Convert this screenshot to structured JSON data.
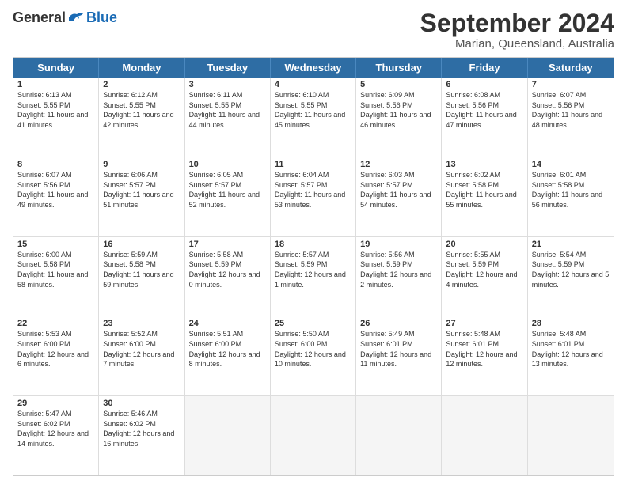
{
  "logo": {
    "general": "General",
    "blue": "Blue"
  },
  "title": "September 2024",
  "location": "Marian, Queensland, Australia",
  "days": [
    "Sunday",
    "Monday",
    "Tuesday",
    "Wednesday",
    "Thursday",
    "Friday",
    "Saturday"
  ],
  "weeks": [
    [
      {
        "day": "1",
        "sunrise": "6:13 AM",
        "sunset": "5:55 PM",
        "daylight": "11 hours and 41 minutes."
      },
      {
        "day": "2",
        "sunrise": "6:12 AM",
        "sunset": "5:55 PM",
        "daylight": "11 hours and 42 minutes."
      },
      {
        "day": "3",
        "sunrise": "6:11 AM",
        "sunset": "5:55 PM",
        "daylight": "11 hours and 44 minutes."
      },
      {
        "day": "4",
        "sunrise": "6:10 AM",
        "sunset": "5:55 PM",
        "daylight": "11 hours and 45 minutes."
      },
      {
        "day": "5",
        "sunrise": "6:09 AM",
        "sunset": "5:56 PM",
        "daylight": "11 hours and 46 minutes."
      },
      {
        "day": "6",
        "sunrise": "6:08 AM",
        "sunset": "5:56 PM",
        "daylight": "11 hours and 47 minutes."
      },
      {
        "day": "7",
        "sunrise": "6:07 AM",
        "sunset": "5:56 PM",
        "daylight": "11 hours and 48 minutes."
      }
    ],
    [
      {
        "day": "8",
        "sunrise": "6:07 AM",
        "sunset": "5:56 PM",
        "daylight": "11 hours and 49 minutes."
      },
      {
        "day": "9",
        "sunrise": "6:06 AM",
        "sunset": "5:57 PM",
        "daylight": "11 hours and 51 minutes."
      },
      {
        "day": "10",
        "sunrise": "6:05 AM",
        "sunset": "5:57 PM",
        "daylight": "11 hours and 52 minutes."
      },
      {
        "day": "11",
        "sunrise": "6:04 AM",
        "sunset": "5:57 PM",
        "daylight": "11 hours and 53 minutes."
      },
      {
        "day": "12",
        "sunrise": "6:03 AM",
        "sunset": "5:57 PM",
        "daylight": "11 hours and 54 minutes."
      },
      {
        "day": "13",
        "sunrise": "6:02 AM",
        "sunset": "5:58 PM",
        "daylight": "11 hours and 55 minutes."
      },
      {
        "day": "14",
        "sunrise": "6:01 AM",
        "sunset": "5:58 PM",
        "daylight": "11 hours and 56 minutes."
      }
    ],
    [
      {
        "day": "15",
        "sunrise": "6:00 AM",
        "sunset": "5:58 PM",
        "daylight": "11 hours and 58 minutes."
      },
      {
        "day": "16",
        "sunrise": "5:59 AM",
        "sunset": "5:58 PM",
        "daylight": "11 hours and 59 minutes."
      },
      {
        "day": "17",
        "sunrise": "5:58 AM",
        "sunset": "5:59 PM",
        "daylight": "12 hours and 0 minutes."
      },
      {
        "day": "18",
        "sunrise": "5:57 AM",
        "sunset": "5:59 PM",
        "daylight": "12 hours and 1 minute."
      },
      {
        "day": "19",
        "sunrise": "5:56 AM",
        "sunset": "5:59 PM",
        "daylight": "12 hours and 2 minutes."
      },
      {
        "day": "20",
        "sunrise": "5:55 AM",
        "sunset": "5:59 PM",
        "daylight": "12 hours and 4 minutes."
      },
      {
        "day": "21",
        "sunrise": "5:54 AM",
        "sunset": "5:59 PM",
        "daylight": "12 hours and 5 minutes."
      }
    ],
    [
      {
        "day": "22",
        "sunrise": "5:53 AM",
        "sunset": "6:00 PM",
        "daylight": "12 hours and 6 minutes."
      },
      {
        "day": "23",
        "sunrise": "5:52 AM",
        "sunset": "6:00 PM",
        "daylight": "12 hours and 7 minutes."
      },
      {
        "day": "24",
        "sunrise": "5:51 AM",
        "sunset": "6:00 PM",
        "daylight": "12 hours and 8 minutes."
      },
      {
        "day": "25",
        "sunrise": "5:50 AM",
        "sunset": "6:00 PM",
        "daylight": "12 hours and 10 minutes."
      },
      {
        "day": "26",
        "sunrise": "5:49 AM",
        "sunset": "6:01 PM",
        "daylight": "12 hours and 11 minutes."
      },
      {
        "day": "27",
        "sunrise": "5:48 AM",
        "sunset": "6:01 PM",
        "daylight": "12 hours and 12 minutes."
      },
      {
        "day": "28",
        "sunrise": "5:48 AM",
        "sunset": "6:01 PM",
        "daylight": "12 hours and 13 minutes."
      }
    ],
    [
      {
        "day": "29",
        "sunrise": "5:47 AM",
        "sunset": "6:02 PM",
        "daylight": "12 hours and 14 minutes."
      },
      {
        "day": "30",
        "sunrise": "5:46 AM",
        "sunset": "6:02 PM",
        "daylight": "12 hours and 16 minutes."
      },
      null,
      null,
      null,
      null,
      null
    ]
  ]
}
